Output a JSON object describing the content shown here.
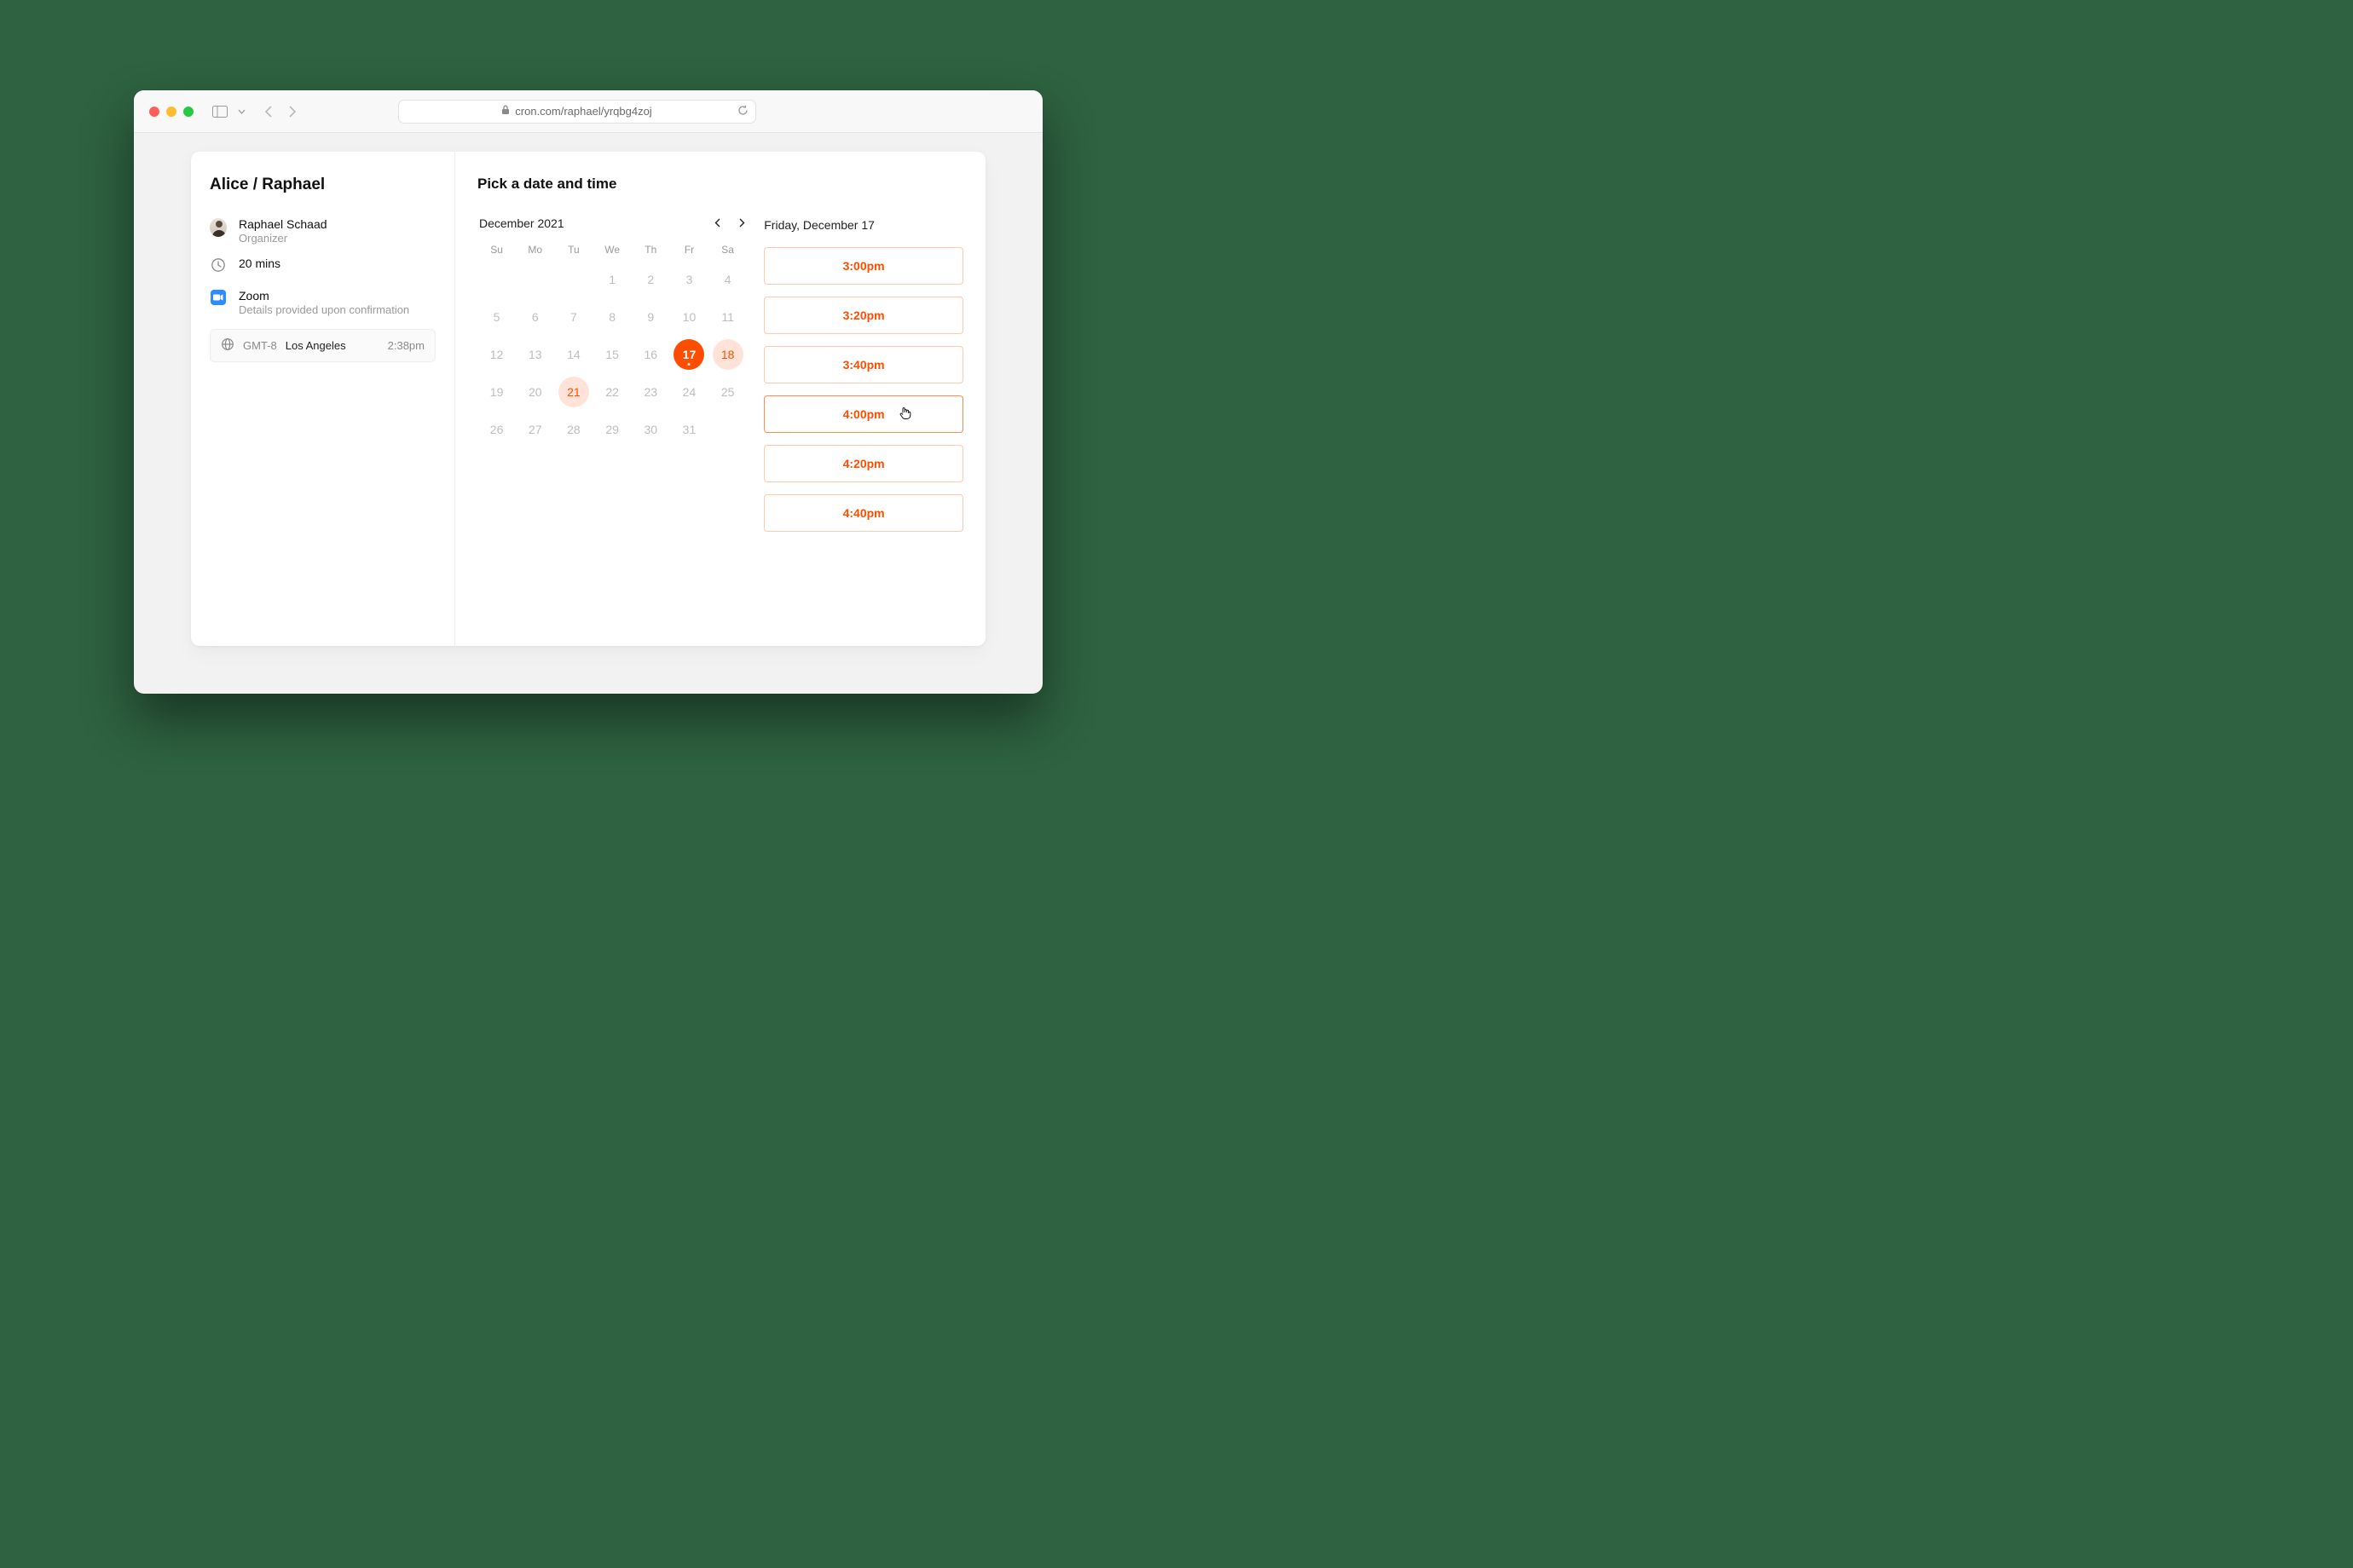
{
  "browser": {
    "url": "cron.com/raphael/yrqbg4zoj"
  },
  "sidebar": {
    "title": "Alice / Raphael",
    "organizer_name": "Raphael Schaad",
    "organizer_role": "Organizer",
    "duration": "20 mins",
    "conference_name": "Zoom",
    "conference_detail": "Details provided upon confirmation",
    "tz_label": "GMT-8",
    "tz_city": "Los Angeles",
    "tz_time": "2:38pm"
  },
  "main": {
    "heading": "Pick a date and time",
    "month_label": "December 2021",
    "dow": [
      "Su",
      "Mo",
      "Tu",
      "We",
      "Th",
      "Fr",
      "Sa"
    ],
    "weeks": [
      [
        {
          "n": "",
          "state": "empty"
        },
        {
          "n": "",
          "state": "empty"
        },
        {
          "n": "",
          "state": "empty"
        },
        {
          "n": "1",
          "state": "muted"
        },
        {
          "n": "2",
          "state": "muted"
        },
        {
          "n": "3",
          "state": "muted"
        },
        {
          "n": "4",
          "state": "muted"
        }
      ],
      [
        {
          "n": "5",
          "state": "muted"
        },
        {
          "n": "6",
          "state": "muted"
        },
        {
          "n": "7",
          "state": "muted"
        },
        {
          "n": "8",
          "state": "muted"
        },
        {
          "n": "9",
          "state": "muted"
        },
        {
          "n": "10",
          "state": "muted"
        },
        {
          "n": "11",
          "state": "muted"
        }
      ],
      [
        {
          "n": "12",
          "state": "muted"
        },
        {
          "n": "13",
          "state": "muted"
        },
        {
          "n": "14",
          "state": "muted"
        },
        {
          "n": "15",
          "state": "muted"
        },
        {
          "n": "16",
          "state": "muted"
        },
        {
          "n": "17",
          "state": "selected"
        },
        {
          "n": "18",
          "state": "avail"
        }
      ],
      [
        {
          "n": "19",
          "state": "muted"
        },
        {
          "n": "20",
          "state": "muted"
        },
        {
          "n": "21",
          "state": "avail"
        },
        {
          "n": "22",
          "state": "muted"
        },
        {
          "n": "23",
          "state": "muted"
        },
        {
          "n": "24",
          "state": "muted"
        },
        {
          "n": "25",
          "state": "muted"
        }
      ],
      [
        {
          "n": "26",
          "state": "muted"
        },
        {
          "n": "27",
          "state": "muted"
        },
        {
          "n": "28",
          "state": "muted"
        },
        {
          "n": "29",
          "state": "muted"
        },
        {
          "n": "30",
          "state": "muted"
        },
        {
          "n": "31",
          "state": "muted"
        },
        {
          "n": "",
          "state": "empty"
        }
      ]
    ],
    "selected_date_label": "Friday, December 17",
    "slots": [
      {
        "label": "3:00pm",
        "hover": false
      },
      {
        "label": "3:20pm",
        "hover": false
      },
      {
        "label": "3:40pm",
        "hover": false
      },
      {
        "label": "4:00pm",
        "hover": true
      },
      {
        "label": "4:20pm",
        "hover": false
      },
      {
        "label": "4:40pm",
        "hover": false
      }
    ]
  }
}
